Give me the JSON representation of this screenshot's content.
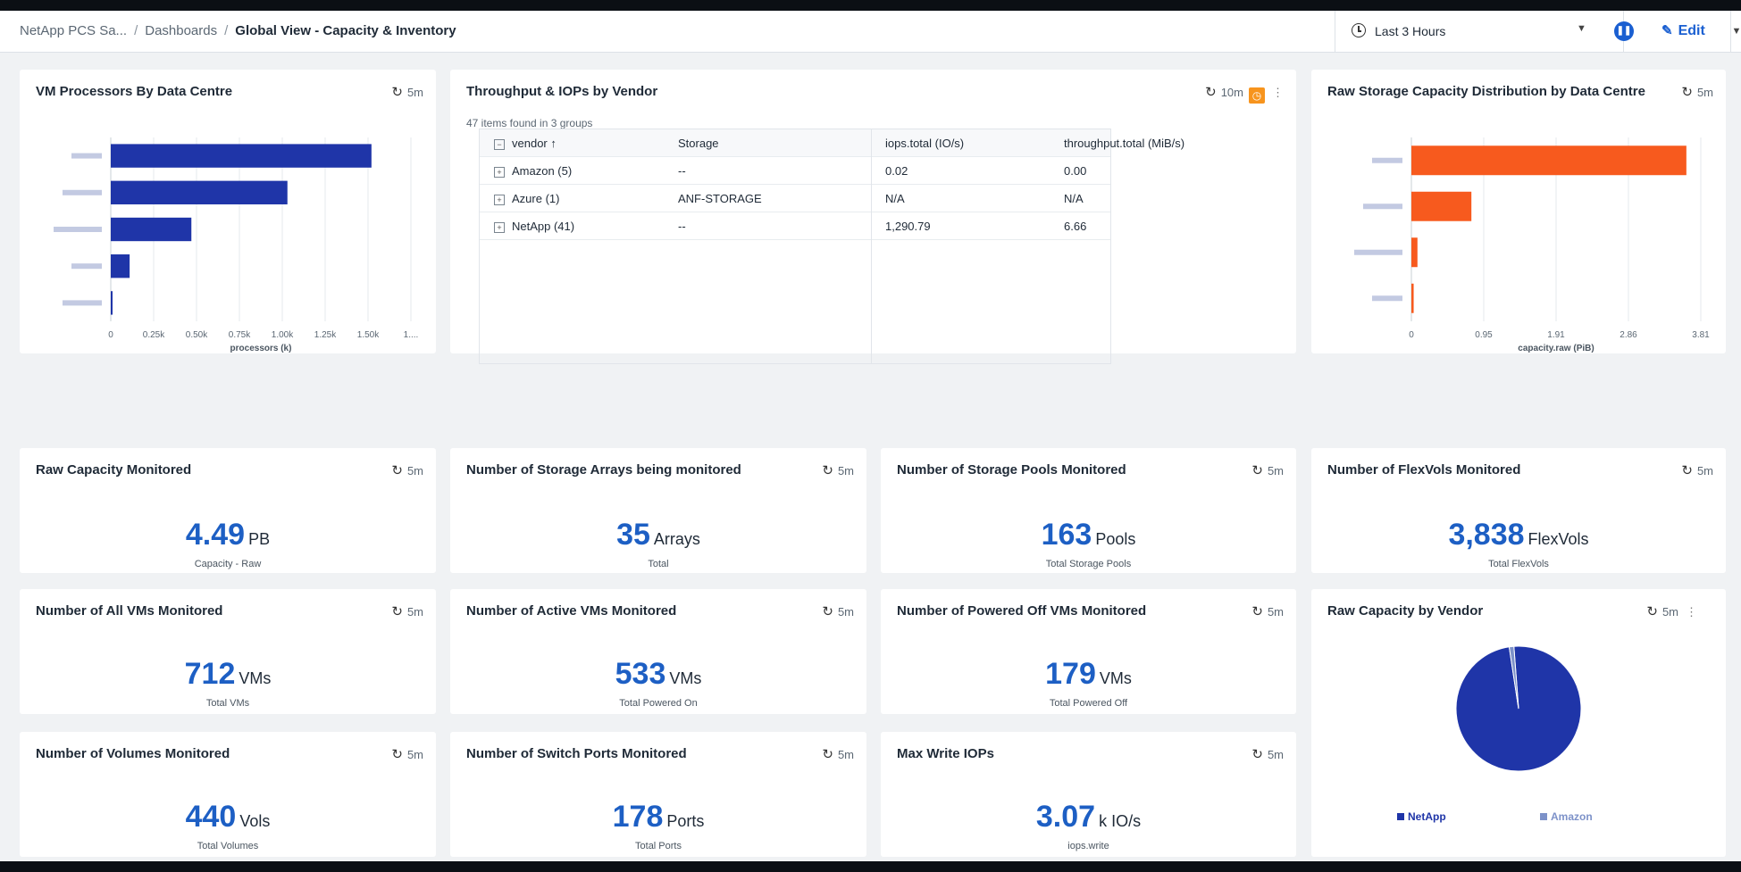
{
  "header": {
    "breadcrumb": [
      "NetApp PCS Sa...",
      "Dashboards",
      "Global View - Capacity & Inventory"
    ],
    "separator": "/",
    "time_range": "Last 3 Hours",
    "edit_label": "Edit"
  },
  "vm_processors": {
    "title": "VM Processors By Data Centre",
    "refresh": "5m",
    "chart_data": {
      "type": "bar",
      "orientation": "horizontal",
      "values": [
        1.52,
        1.03,
        0.47,
        0.11,
        0.01
      ],
      "xticks": [
        "0",
        "0.25k",
        "0.50k",
        "0.75k",
        "1.00k",
        "1.25k",
        "1.50k",
        "1...."
      ],
      "xlabel": "processors (k)",
      "xlim": [
        0,
        1.75
      ],
      "color": "#1f35a8"
    }
  },
  "throughput": {
    "title": "Throughput & IOPs by Vendor",
    "refresh": "10m",
    "items_found": "47 items found in 3 groups",
    "columns": [
      "vendor",
      "Storage",
      "iops.total (IO/s)",
      "throughput.total (MiB/s)"
    ],
    "sort_arrow": "↑",
    "rows": [
      {
        "vendor": "Amazon (5)",
        "storage": "--",
        "iops": "0.02",
        "throughput": "0.00"
      },
      {
        "vendor": "Azure (1)",
        "storage": "ANF-STORAGE",
        "iops": "N/A",
        "throughput": "N/A"
      },
      {
        "vendor": "NetApp (41)",
        "storage": "--",
        "iops": "1,290.79",
        "throughput": "6.66"
      }
    ]
  },
  "raw_storage": {
    "title": "Raw Storage Capacity Distribution by Data Centre",
    "refresh": "5m",
    "chart_data": {
      "type": "bar",
      "orientation": "horizontal",
      "values": [
        3.62,
        0.79,
        0.08,
        0.03
      ],
      "xticks": [
        "0",
        "0.95",
        "1.91",
        "2.86",
        "3.81"
      ],
      "xlabel": "capacity.raw (PiB)",
      "xlim": [
        0,
        3.81
      ],
      "color": "#f75a1e"
    }
  },
  "stats": [
    {
      "title": "Raw Capacity Monitored",
      "refresh": "5m",
      "value": "4.49",
      "unit": "PB",
      "sub": "Capacity - Raw"
    },
    {
      "title": "Number of Storage Arrays being monitored",
      "refresh": "5m",
      "value": "35",
      "unit": "Arrays",
      "sub": "Total"
    },
    {
      "title": "Number of Storage Pools Monitored",
      "refresh": "5m",
      "value": "163",
      "unit": "Pools",
      "sub": "Total Storage Pools"
    },
    {
      "title": "Number of FlexVols Monitored",
      "refresh": "5m",
      "value": "3,838",
      "unit": "FlexVols",
      "sub": "Total FlexVols"
    },
    {
      "title": "Number of All VMs Monitored",
      "refresh": "5m",
      "value": "712",
      "unit": "VMs",
      "sub": "Total VMs"
    },
    {
      "title": "Number of Active VMs Monitored",
      "refresh": "5m",
      "value": "533",
      "unit": "VMs",
      "sub": "Total Powered On"
    },
    {
      "title": "Number of Powered Off VMs Monitored",
      "refresh": "5m",
      "value": "179",
      "unit": "VMs",
      "sub": "Total Powered Off"
    },
    {
      "title": "Number of Volumes Monitored",
      "refresh": "5m",
      "value": "440",
      "unit": "Vols",
      "sub": "Total Volumes"
    },
    {
      "title": "Number of Switch Ports Monitored",
      "refresh": "5m",
      "value": "178",
      "unit": "Ports",
      "sub": "Total Ports"
    },
    {
      "title": "Max Write IOPs",
      "refresh": "5m",
      "value": "3.07",
      "unit": "k IO/s",
      "sub": "iops.write"
    }
  ],
  "raw_by_vendor": {
    "title": "Raw Capacity by Vendor",
    "refresh": "5m",
    "chart_data": {
      "type": "pie",
      "slices": [
        {
          "name": "NetApp",
          "value": 98.8,
          "color": "#1f35a8"
        },
        {
          "name": "Amazon",
          "value": 1.2,
          "color": "#7d92c9"
        }
      ]
    }
  }
}
